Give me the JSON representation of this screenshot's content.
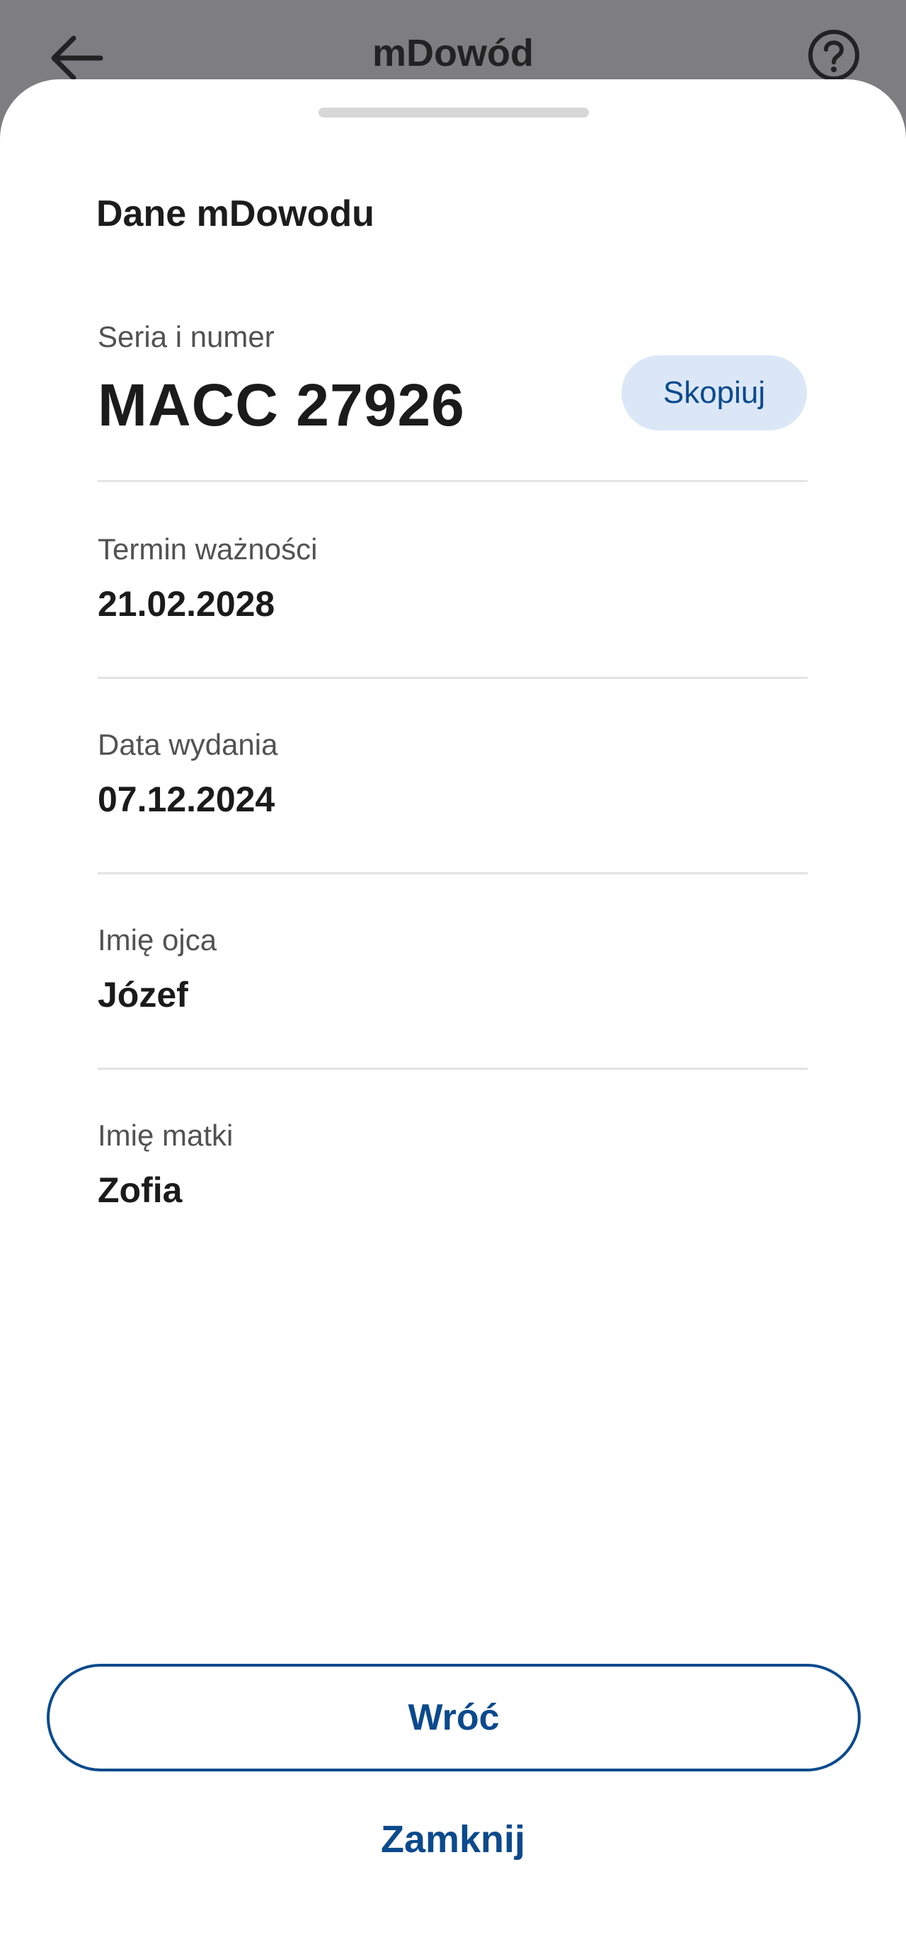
{
  "app_bar": {
    "title": "mDowód",
    "back_icon": "arrow-left-icon",
    "help_icon": "question-circle-icon"
  },
  "sheet": {
    "title": "Dane mDowodu",
    "fields": [
      {
        "label": "Seria i numer",
        "value": "MACC 27926"
      },
      {
        "label": "Termin ważności",
        "value": "21.02.2028"
      },
      {
        "label": "Data wydania",
        "value": "07.12.2024"
      },
      {
        "label": "Imię ojca",
        "value": "Józef"
      },
      {
        "label": "Imię matki",
        "value": "Zofia"
      }
    ],
    "copy_label": "Skopiuj",
    "back_label": "Wróć",
    "close_label": "Zamknij"
  },
  "colors": {
    "accent": "#0b4a8d",
    "copy_bg": "#dbe7f7",
    "scrim": "#7e7e80"
  }
}
